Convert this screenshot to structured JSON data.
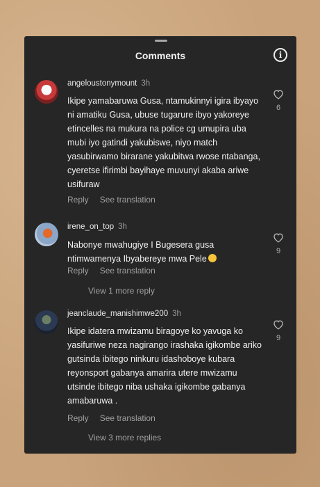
{
  "header": {
    "title": "Comments"
  },
  "comments": [
    {
      "username": "angeloustonymount",
      "time": "3h",
      "text": "Ikipe yamabaruwa Gusa, ntamukinnyi igira ibyayo ni amatiku Gusa, ubuse tugarure ibyo yakoreye etincelles na mukura na police cg umupira uba mubi iyo gatindi yakubiswe, niyo match yasubirwamo birarane yakubitwa rwose ntabanga, cyeretse ifirimbi bayihaye muvunyi akaba ariwe usifuraw",
      "reply": "Reply",
      "see_translation": "See translation",
      "likes": "6"
    },
    {
      "username": "irene_on_top",
      "time": "3h",
      "text": "Nabonye mwahugiye I Bugesera gusa ntimwamenya Ibyabereye  mwa Pele",
      "emoji": "grinning-sweat-emoji",
      "reply": "Reply",
      "see_translation": "See translation",
      "likes": "9",
      "view_replies": "View 1 more reply"
    },
    {
      "username": "jeanclaude_manishimwe200",
      "time": "3h",
      "text": "Ikipe idatera mwizamu biragoye ko yavuga ko yasifuriwe neza nagirango irashaka igikombe ariko gutsinda ibitego ninkuru idashoboye kubara reyonsport gabanya amarira utere mwizamu utsinde ibitego niba ushaka igikombe gabanya amabaruwa .",
      "reply": "Reply",
      "see_translation": "See translation",
      "likes": "9",
      "view_replies": "View 3 more replies"
    }
  ]
}
